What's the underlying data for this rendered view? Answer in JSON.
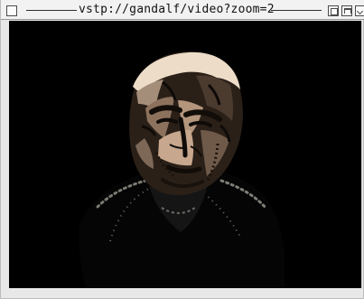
{
  "window": {
    "title": "vstp://gandalf/video?zoom=2"
  },
  "icons": {
    "close": "close-icon",
    "zoom": "zoom-icon",
    "collapse": "collapse-icon",
    "minimize": "minimize-icon"
  },
  "colors": {
    "video_background": "#000000",
    "titlebar_background": "#f2f2f2"
  }
}
